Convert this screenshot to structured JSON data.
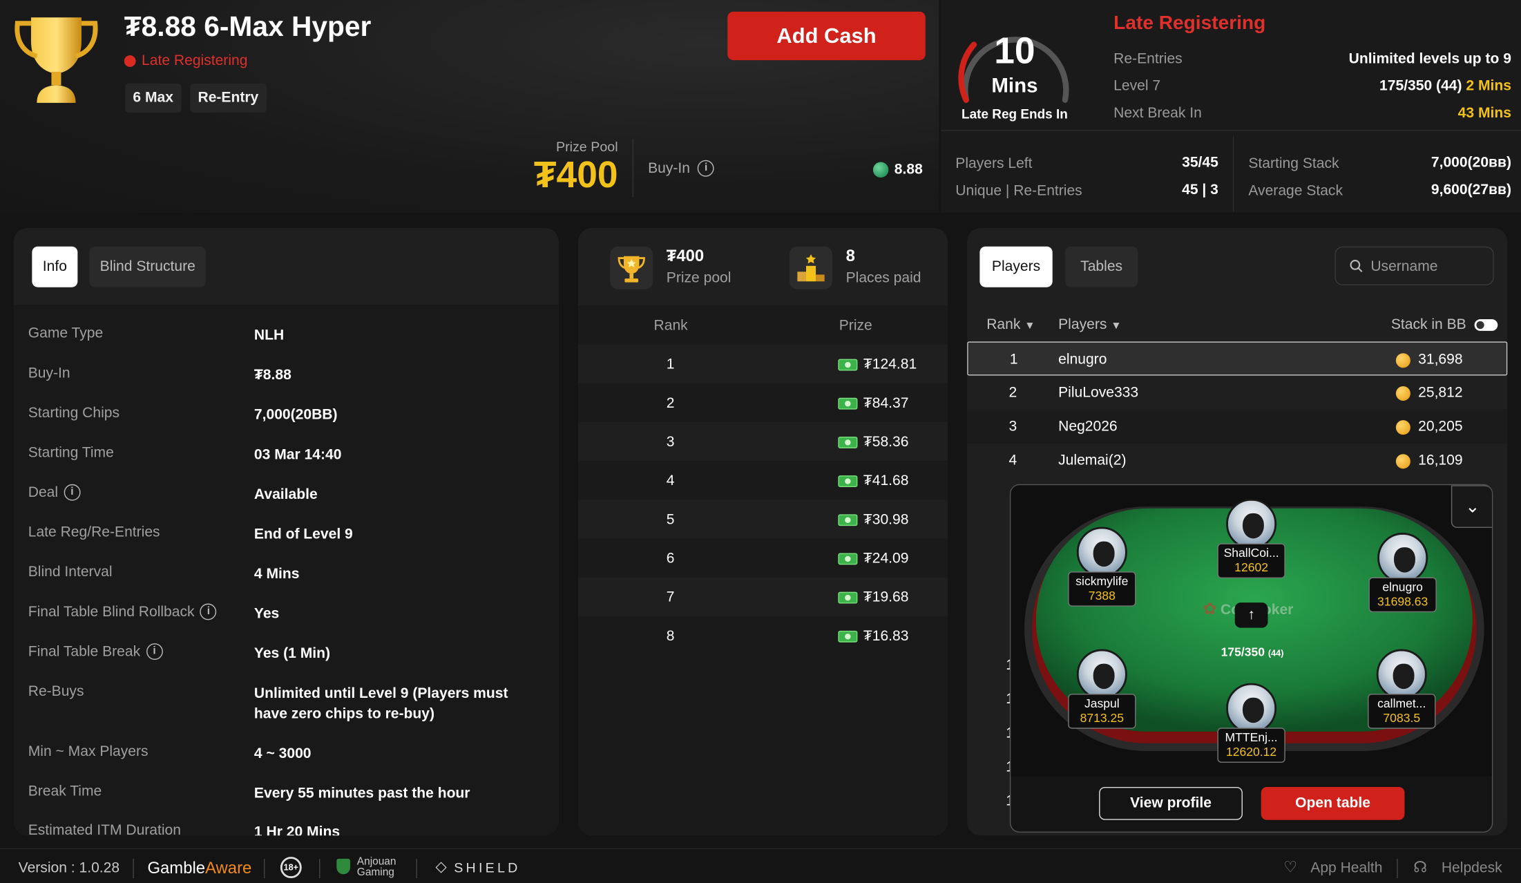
{
  "header": {
    "title": "₮8.88 6-Max Hyper",
    "status": "Late Registering",
    "tags": [
      "6 Max",
      "Re-Entry"
    ],
    "add_cash": "Add Cash",
    "prize_pool_label": "Prize Pool",
    "prize_pool_value": "₮400",
    "buyin_label": "Buy-In",
    "buyin_value": "8.88"
  },
  "late_reg": {
    "timer_value": "10",
    "timer_unit": "Mins",
    "timer_label": "Late Reg Ends In",
    "title": "Late Registering",
    "rows": [
      {
        "label": "Re-Entries",
        "value": "Unlimited levels up to 9"
      },
      {
        "label": "Level 7",
        "value": "175/350 (44)",
        "extra": "2 Mins"
      },
      {
        "label": "Next Break In",
        "value": "43 Mins"
      }
    ],
    "stats_left": [
      {
        "label": "Players Left",
        "value": "35/45"
      },
      {
        "label": "Unique | Re-Entries",
        "value": "45 | 3"
      }
    ],
    "stats_right": [
      {
        "label": "Starting Stack",
        "value": "7,000(20ʙʙ)"
      },
      {
        "label": "Average Stack",
        "value": "9,600(27ʙʙ)"
      }
    ]
  },
  "info_panel": {
    "tabs": [
      "Info",
      "Blind Structure"
    ],
    "rows": [
      {
        "label": "Game Type",
        "value": "NLH"
      },
      {
        "label": "Buy-In",
        "value": "₮8.88"
      },
      {
        "label": "Starting Chips",
        "value": "7,000(20BB)"
      },
      {
        "label": "Starting Time",
        "value": "03 Mar 14:40"
      },
      {
        "label": "Deal",
        "value": "Available",
        "info": true
      },
      {
        "label": "Late Reg/Re-Entries",
        "value": "End of Level 9"
      },
      {
        "label": "Blind Interval",
        "value": "4 Mins"
      },
      {
        "label": "Final Table Blind Rollback",
        "value": "Yes",
        "info": true
      },
      {
        "label": "Final Table Break",
        "value": "Yes (1 Min)",
        "info": true
      },
      {
        "label": "Re-Buys",
        "value": "Unlimited until Level 9 (Players must have zero chips to re-buy)"
      },
      {
        "label": "Min ~ Max Players",
        "value": "4 ~ 3000"
      },
      {
        "label": "Break Time",
        "value": "Every 55 minutes past the hour"
      },
      {
        "label": "Estimated ITM Duration",
        "value": "1 Hr 20 Mins"
      }
    ]
  },
  "prize_panel": {
    "pool_value": "₮400",
    "pool_label": "Prize pool",
    "places_value": "8",
    "places_label": "Places paid",
    "col_rank": "Rank",
    "col_prize": "Prize",
    "rows": [
      {
        "rank": "1",
        "prize": "₮124.81"
      },
      {
        "rank": "2",
        "prize": "₮84.37"
      },
      {
        "rank": "3",
        "prize": "₮58.36"
      },
      {
        "rank": "4",
        "prize": "₮41.68"
      },
      {
        "rank": "5",
        "prize": "₮30.98"
      },
      {
        "rank": "6",
        "prize": "₮24.09"
      },
      {
        "rank": "7",
        "prize": "₮19.68"
      },
      {
        "rank": "8",
        "prize": "₮16.83"
      }
    ]
  },
  "players_panel": {
    "tabs": [
      "Players",
      "Tables"
    ],
    "search_placeholder": "Username",
    "col_rank": "Rank",
    "col_players": "Players",
    "col_stack": "Stack in BB",
    "rows": [
      {
        "rank": "1",
        "name": "elnugro",
        "stack": "31,698"
      },
      {
        "rank": "2",
        "name": "PiluLove333",
        "stack": "25,812"
      },
      {
        "rank": "3",
        "name": "Neg2026",
        "stack": "20,205"
      },
      {
        "rank": "4",
        "name": "Julemai(2)",
        "stack": "16,109"
      }
    ],
    "hidden_rank_digits": [
      "1",
      "1",
      "1",
      "1",
      "1"
    ]
  },
  "table_popup": {
    "brand": "CoinPoker",
    "blinds": "175/350",
    "ante": "(44)",
    "seats": [
      {
        "name": "ShallCoi...",
        "stack": "12602"
      },
      {
        "name": "sickmylife",
        "stack": "7388"
      },
      {
        "name": "elnugro",
        "stack": "31698.63"
      },
      {
        "name": "Jaspul",
        "stack": "8713.25"
      },
      {
        "name": "MTTEnj...",
        "stack": "12620.12"
      },
      {
        "name": "callmet...",
        "stack": "7083.5"
      }
    ],
    "view_profile": "View profile",
    "open_table": "Open table"
  },
  "footer": {
    "version": "Version : 1.0.28",
    "gamble": "Gamble",
    "aware": "Aware",
    "age": "18+",
    "anjouan_1": "Anjouan",
    "anjouan_2": "Gaming",
    "shield": "SHIELD",
    "app_health": "App Health",
    "helpdesk": "Helpdesk"
  },
  "colors": {
    "accent_red": "#d1211b",
    "gold": "#f2c21a",
    "felt": "#1f8a3f"
  }
}
